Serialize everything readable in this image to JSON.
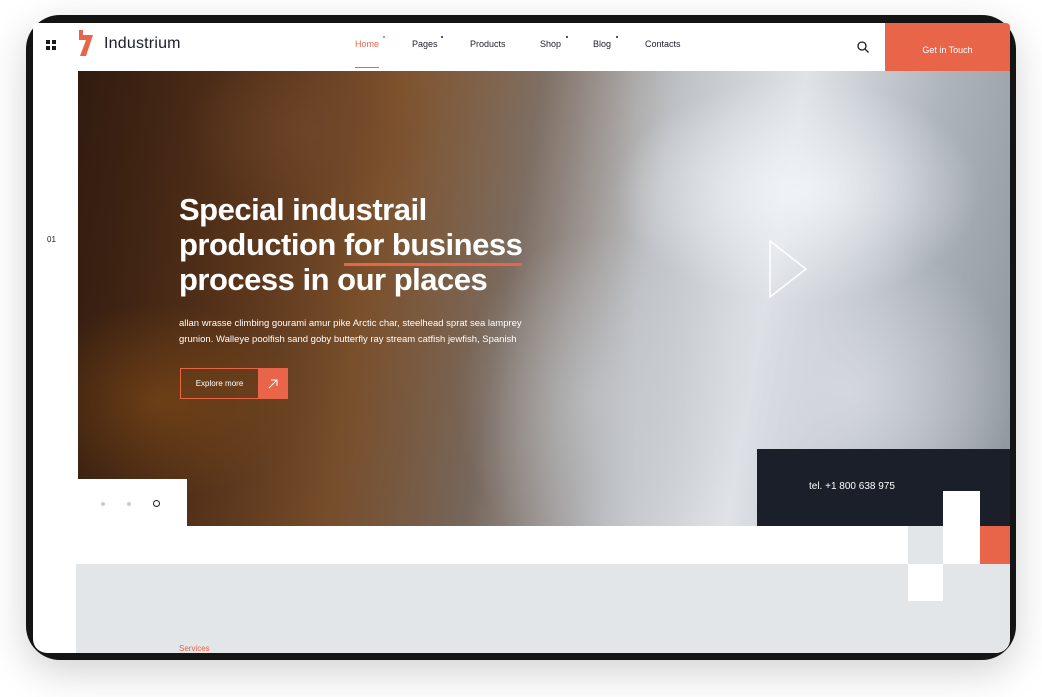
{
  "brand": {
    "name": "Industrium",
    "accent": "#e8654a",
    "dark": "#1b1f2a"
  },
  "header": {
    "menu_icon": "grid-icon",
    "nav": [
      {
        "label": "Home",
        "active": true,
        "has_dropdown": true
      },
      {
        "label": "Pages",
        "active": false,
        "has_dropdown": true
      },
      {
        "label": "Products",
        "active": false,
        "has_dropdown": false
      },
      {
        "label": "Shop",
        "active": false,
        "has_dropdown": true
      },
      {
        "label": "Blog",
        "active": false,
        "has_dropdown": true
      },
      {
        "label": "Contacts",
        "active": false,
        "has_dropdown": false
      }
    ],
    "search_icon": "search-icon",
    "cta_label": "Get in Touch"
  },
  "slider": {
    "number": "01",
    "title_lines": [
      "Special industrail",
      "production ",
      "for business",
      "process in our places"
    ],
    "description": "allan wrasse climbing gourami amur pike Arctic char, steelhead sprat sea lamprey grunion. Walleye poolfish sand goby butterfly ray stream catfish jewfish, Spanish",
    "button_label": "Explore more",
    "button_icon": "arrow-up-right-icon",
    "play_icon": "play-icon",
    "pagination": {
      "count": 3,
      "active": 3
    },
    "phone": "tel. +1 800 638 975"
  },
  "services": {
    "label": "Services"
  }
}
